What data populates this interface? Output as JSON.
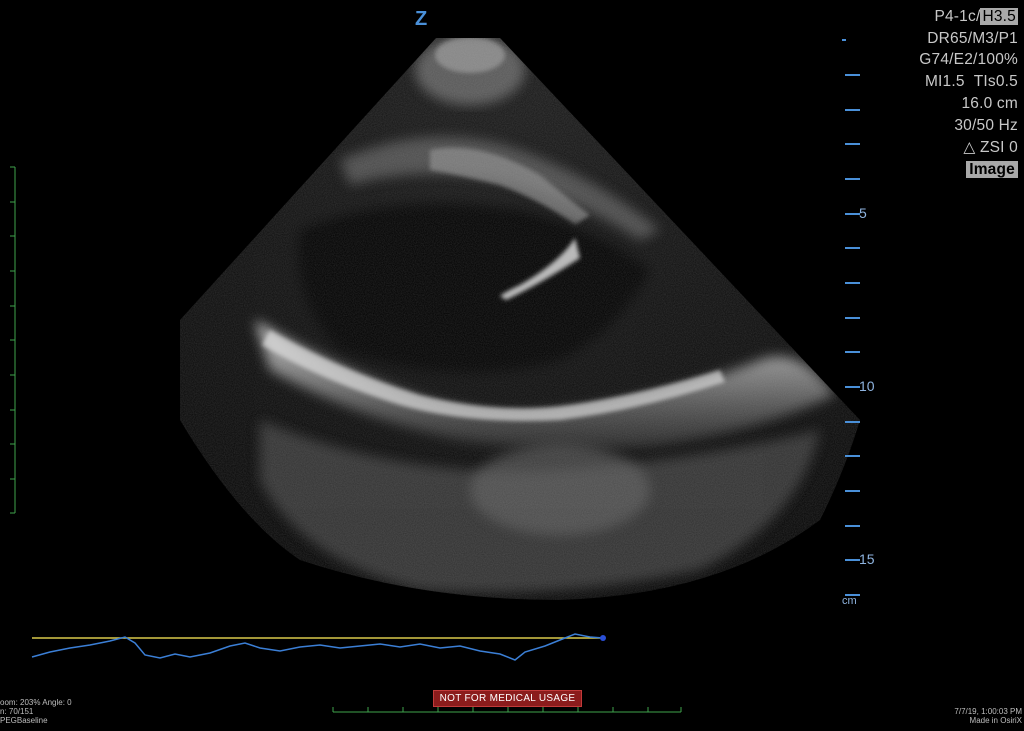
{
  "probe_orientation_marker": "Z",
  "acquisition": {
    "transducer": "P4-1c/",
    "frequency": "H3.5",
    "dynamic_range": "DR65/M3/P1",
    "gain": "G74/E2/100%",
    "mechanical_index": "MI1.5",
    "thermal_index": "TIs0.5",
    "depth": "16.0 cm",
    "frame_rate": "30/50 Hz",
    "zsi": "ZSI 0",
    "mode": "Image"
  },
  "depth_scale": {
    "labels": [
      "5",
      "10",
      "15"
    ],
    "unit": "cm"
  },
  "overlay": {
    "zoom": "oom: 203% Angle: 0",
    "frame": "n: 70/151",
    "compression": "PEGBaseline",
    "timestamp": "7/7/19, 1:00:03 PM",
    "made_in": "Made in OsiriX"
  },
  "warning_label": "NOT FOR MEDICAL USAGE",
  "colors": {
    "depth_scale": "#4a90d9",
    "left_scale": "#3fa34d",
    "ecg_trace": "#3b7fd6",
    "ecg_baseline": "#d9c94a",
    "warning_bg": "#8b1c1c"
  }
}
